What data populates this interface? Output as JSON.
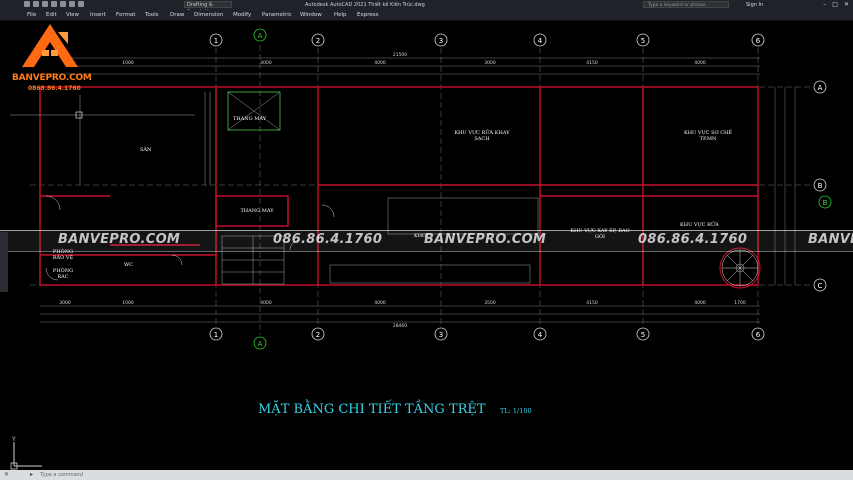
{
  "titlebar": {
    "workspace": "Drafting & Annotation",
    "app_title": "Autodesk AutoCAD 2021",
    "file_name": "Thiết kế Kiến Trúc.dwg",
    "search_placeholder": "Type a keyword or phrase",
    "sign_in": "Sign In"
  },
  "menu": [
    "File",
    "Edit",
    "View",
    "Insert",
    "Format",
    "Tools",
    "Draw",
    "Dimension",
    "Modify",
    "Parametric",
    "Window",
    "Help",
    "Express"
  ],
  "logo": {
    "brand": "BANVEPRO.COM",
    "phone": "0868.86.4.1760",
    "brand_color": "#ff7a1a"
  },
  "watermark": {
    "texts": [
      "BANVEPRO.COM",
      "086.86.4.1760",
      "BANVEPRO.COM",
      "086.86.4.1760",
      "BANVEPRO"
    ]
  },
  "drawing": {
    "title": "MẶT BẰNG CHI TIẾT TẦNG TRỆT",
    "scale": "TL: 1/100",
    "grid_numbers": [
      "1",
      "2",
      "3",
      "4",
      "5",
      "6"
    ],
    "grid_letters": [
      "A",
      "B",
      "C"
    ],
    "axis_a_label": "A",
    "dims_top_total": "21500",
    "dims_bottom_total": "28460",
    "dims_top": [
      "1000",
      "4000",
      "4000",
      "3000",
      "4150",
      "4000"
    ],
    "dims_bottom": [
      "3000",
      "1000",
      "4000",
      "4000",
      "3500",
      "4150",
      "4000",
      "1700"
    ],
    "rooms": {
      "san": "SÂN",
      "thang_may_top": "THANG MÁY",
      "thang_may": "THANG MÁY",
      "khu_vuc_rua_khay": "KHU VỰC RỬA KHAY SẠCH",
      "khu_vuc_so_che": "KHU VỰC SƠ CHẾ TP.MN",
      "khu_vuc_xay": "KHU VỰC XAY ÉP, BAO GÓI",
      "khu_vuc_rua": "KHU VỰC RỬA",
      "phong_bao_ve": "PHÒNG BẢO VỆ",
      "phong_rac": "PHÒNG RÁC",
      "wc": "WC",
      "kho": "KHO"
    },
    "line_color": "#c8102e",
    "text_color": "#35d3e8"
  },
  "command": {
    "placeholder": "Type a command"
  }
}
